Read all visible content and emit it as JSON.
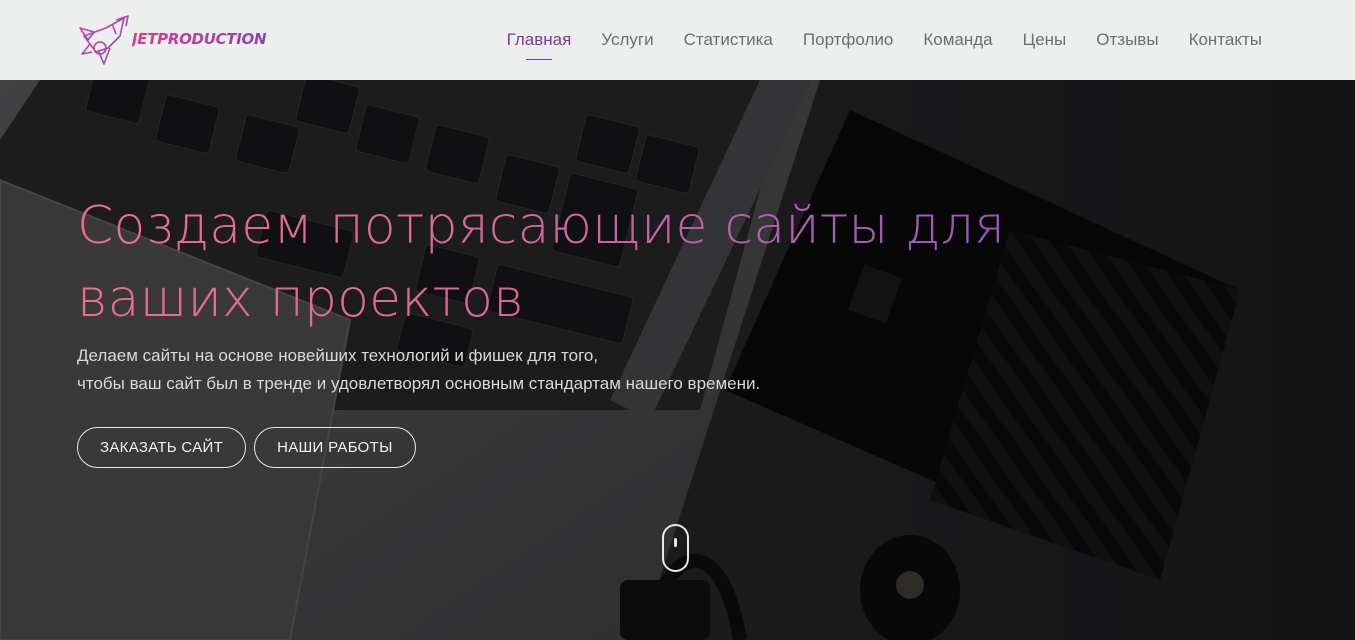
{
  "brand": {
    "logo_text": "JETPRODUCTION",
    "logo_icon": "rocket-icon"
  },
  "nav": {
    "items": [
      {
        "label": "Главная",
        "active": true
      },
      {
        "label": "Услуги"
      },
      {
        "label": "Статистика"
      },
      {
        "label": "Портфолио"
      },
      {
        "label": "Команда"
      },
      {
        "label": "Цены"
      },
      {
        "label": "Отзывы"
      },
      {
        "label": "Контакты"
      }
    ]
  },
  "hero": {
    "title": "Создаем потрясающие сайты для ваших проектов",
    "subtitle_line1": "Делаем сайты на основе новейших технологий и фишек для того,",
    "subtitle_line2": "чтобы ваш сайт был в тренде и удовлетворял основным стандартам нашего времени.",
    "buttons": {
      "order": "ЗАКАЗАТЬ САЙТ",
      "works": "НАШИ РАБОТЫ"
    },
    "scroll_icon": "mouse-scroll-icon"
  },
  "colors": {
    "accent": "#7a3a9a",
    "gradient_start": "#ee6d8d",
    "gradient_end": "#8a4cc0",
    "header_bg": "#edefef"
  }
}
